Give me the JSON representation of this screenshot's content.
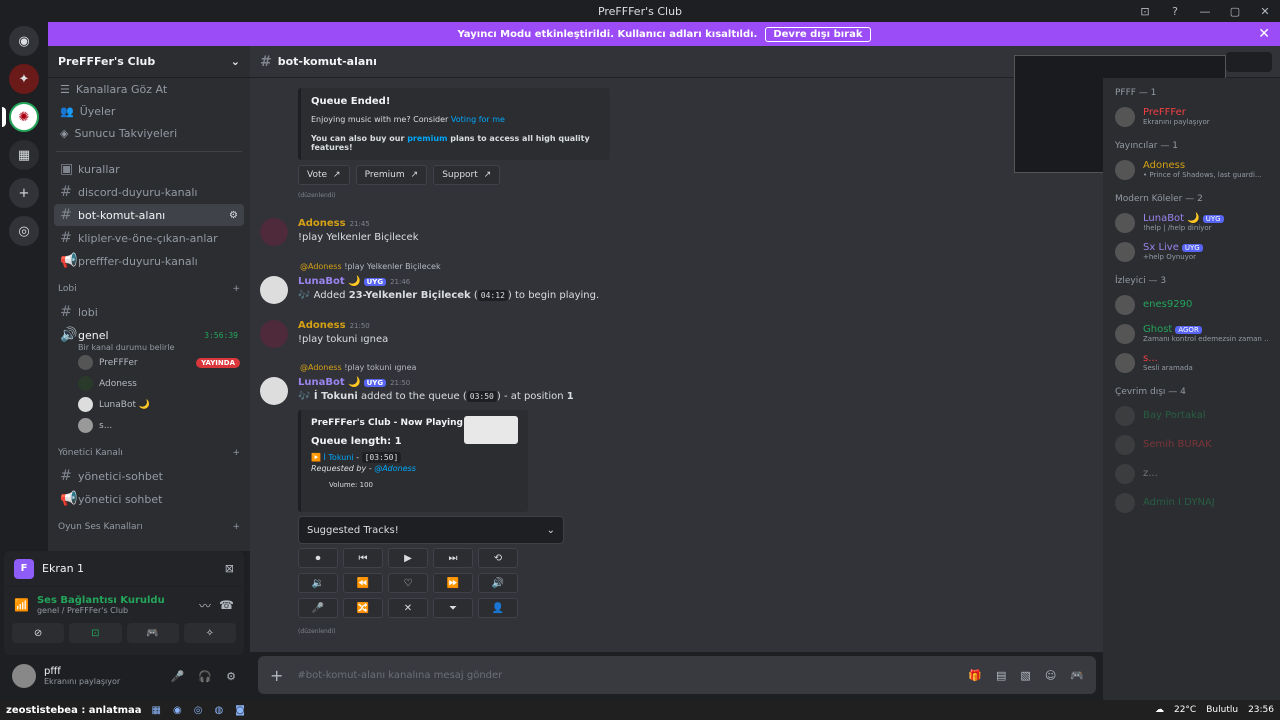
{
  "window": {
    "title": "PreFFFer's Club",
    "controls": [
      "⊡",
      "?",
      "—",
      "▢",
      "✕"
    ]
  },
  "banner": {
    "text": "Yayıncı Modu etkinleştirildi. Kullanıcı adları kısaltıldı.",
    "button": "Devre dışı bırak",
    "close": "✕"
  },
  "server": {
    "name": "PreFFFer's Club",
    "nav": [
      "Kanallara Göz At",
      "Üyeler",
      "Sunucu Takviyeleri"
    ],
    "channels": [
      "kurallar",
      "discord-duyuru-kanalı",
      "bot-komut-alanı",
      "klipler-ve-öne-çıkan-anlar",
      "prefffer-duyuru-kanalı"
    ],
    "active_channel": "bot-komut-alanı",
    "lobby_category": "Lobi",
    "lobby_text": "lobi",
    "voice_channel": "genel",
    "voice_timer": "3:56:39",
    "voice_status": "Bir kanal durumu belirle",
    "voice_users": [
      "PreFFFer",
      "Adoness",
      "LunaBot 🌙",
      "s..."
    ],
    "live_badge": "YAYINDA",
    "admin_category": "Yönetici Kanalı",
    "admin_channels": [
      "yönetici-sohbet",
      "yönetici sohbet"
    ],
    "games_category": "Oyun Ses Kanalları"
  },
  "panel": {
    "screen_label": "Ekran 1",
    "screen_letter": "F",
    "conn_title": "Ses Bağlantısı Kuruldu",
    "conn_sub": "genel / PreFFFer's Club"
  },
  "user": {
    "name": "pfff",
    "status": "Ekranını paylaşıyor"
  },
  "chat": {
    "channel": "bot-komut-alanı",
    "embed1": {
      "title": "Queue Ended!",
      "line1": "Enjoying music with me? Consider",
      "line1_link": "Voting for me",
      "line2a": "You can also buy our",
      "line2_link": "premium",
      "line2b": "plans to access all high quality features!"
    },
    "buttons": [
      "Vote",
      "Premium",
      "Support"
    ],
    "edited": "(düzenlendi)",
    "messages": [
      {
        "author": "Adoness",
        "time": "21:45",
        "body": "!play Yelkenler Biçilecek"
      },
      {
        "reply_name": "@Adoness",
        "reply_text": "!play Yelkenler Biçilecek",
        "author": "LunaBot 🌙",
        "tag": "UYG",
        "time": "21:46",
        "body_a": "🎶 Added",
        "body_bold": "23-Yelkenler Biçilecek",
        "code": "04:12",
        "body_b": "to begin playing."
      },
      {
        "author": "Adoness",
        "time": "21:50",
        "body": "!play tokuni ıgnea"
      },
      {
        "reply_name": "@Adoness",
        "reply_text": "!play tokuni ıgnea",
        "author": "LunaBot 🌙",
        "tag": "UYG",
        "time": "21:50",
        "body_bold": "🎶 İ Tokuni",
        "body_a": "added to the queue",
        "code": "03:50",
        "body_b": "- at position",
        "pos": "1"
      }
    ],
    "embed2": {
      "title": "PreFFFer's Club - Now Playing",
      "queue": "Queue length: 1",
      "track": "▶️ İ Tokuni",
      "track_dur": "[03:50]",
      "requested": "Requested by -",
      "req_user": "@Adoness",
      "volume": "Volume: 100"
    },
    "select": "Suggested Tracks!",
    "controls": [
      "⏺",
      "⏮",
      "▶",
      "⏭",
      "⟲",
      "🔉",
      "⏪",
      "♡",
      "⏩",
      "🔊",
      "🎤",
      "🔀",
      "✕",
      "⏷",
      "👤"
    ]
  },
  "composer": {
    "placeholder": "#bot-komut-alanı kanalına mesaj gönder"
  },
  "members": [
    {
      "cat": "PFFF — 1",
      "items": [
        {
          "name": "PreFFFer",
          "sub": "Ekranını paylaşıyor",
          "color": "#f23f43"
        }
      ]
    },
    {
      "cat": "Yayıncılar — 1",
      "items": [
        {
          "name": "Adoness",
          "sub": "• Prince of Shadows, last guardi...",
          "color": "#d4a014"
        }
      ]
    },
    {
      "cat": "Modern Köleler — 2",
      "items": [
        {
          "name": "LunaBot 🌙",
          "sub": "!help | /help diniyor",
          "color": "#9b84ee",
          "tag": "UYG"
        },
        {
          "name": "Sx Live",
          "sub": "+help Oynuyor",
          "color": "#9b84ee",
          "tag": "UYG"
        }
      ]
    },
    {
      "cat": "İzleyici — 3",
      "items": [
        {
          "name": "enes9290",
          "sub": "",
          "color": "#23a55a"
        },
        {
          "name": "Ghost",
          "sub": "Zamanı kontrol edemezsin zaman ...",
          "color": "#23a55a",
          "tag": "AGOR"
        },
        {
          "name": "s...",
          "sub": "Sesli aramada",
          "color": "#f23f43"
        }
      ]
    },
    {
      "cat": "Çevrim dışı — 4",
      "items": [
        {
          "name": "Bay Portakal",
          "sub": "",
          "color": "#23a55a"
        },
        {
          "name": "Semih BURAK",
          "sub": "",
          "color": "#f23f43"
        },
        {
          "name": "z...",
          "sub": "",
          "color": "#dbdee1"
        },
        {
          "name": "Admin I DYNAJ",
          "sub": "",
          "color": "#23a55a"
        }
      ]
    }
  ],
  "taskbar": {
    "left_text": "zeostistebea : anlatmaa",
    "temp": "22°C",
    "weather": "Bulutlu",
    "clock": "23:56"
  }
}
